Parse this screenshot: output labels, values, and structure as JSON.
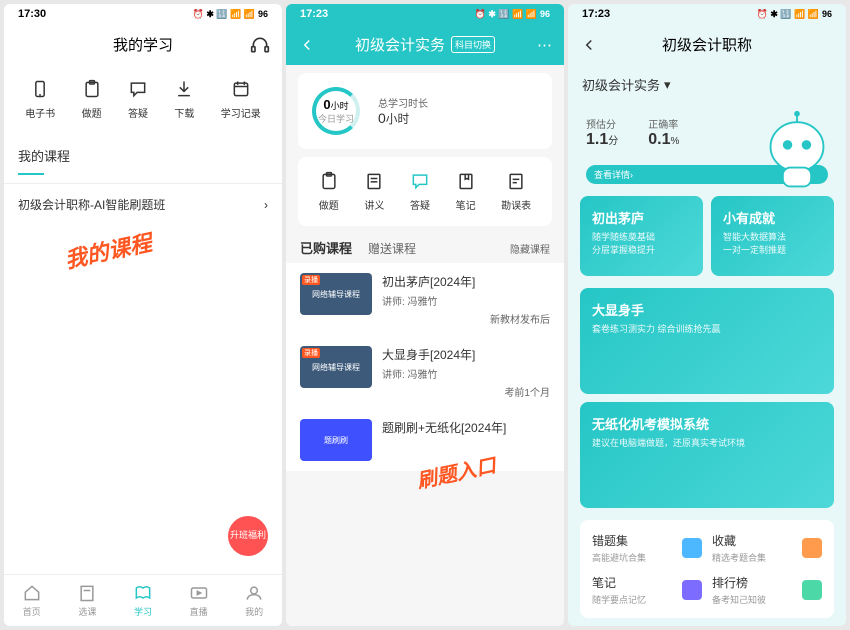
{
  "p1": {
    "time": "17:30",
    "status_badge": "43",
    "battery": "96",
    "title": "我的学习",
    "icons": [
      {
        "name": "ebook-icon",
        "label": "电子书"
      },
      {
        "name": "practice-icon",
        "label": "做题"
      },
      {
        "name": "qa-icon",
        "label": "答疑"
      },
      {
        "name": "download-icon",
        "label": "下载"
      },
      {
        "name": "record-icon",
        "label": "学习记录"
      }
    ],
    "section": "我的课程",
    "course": "初级会计职称-AI智能刷题班",
    "stamp": "我的课程",
    "fab": "升班福利",
    "nav": [
      {
        "name": "home",
        "label": "首页"
      },
      {
        "name": "select",
        "label": "选课"
      },
      {
        "name": "study",
        "label": "学习",
        "active": true
      },
      {
        "name": "live",
        "label": "直播"
      },
      {
        "name": "mine",
        "label": "我的"
      }
    ]
  },
  "p2": {
    "time": "17:23",
    "status_badge": "43",
    "battery": "96",
    "title": "初级会计实务",
    "switch": "科目切换",
    "stats": {
      "today_val": "0",
      "today_unit": "小时",
      "today_label": "今日学习",
      "total_label": "总学习时长",
      "total_val": "0",
      "total_unit": "小时"
    },
    "icons": [
      {
        "name": "practice-icon",
        "label": "做题"
      },
      {
        "name": "lecture-icon",
        "label": "讲义"
      },
      {
        "name": "qa-icon",
        "label": "答疑"
      },
      {
        "name": "notes-icon",
        "label": "笔记"
      },
      {
        "name": "errata-icon",
        "label": "勘误表"
      }
    ],
    "tabs": {
      "t1": "已购课程",
      "t2": "赠送课程",
      "right": "隐藏课程"
    },
    "courses": [
      {
        "title": "初出茅庐[2024年]",
        "teacher": "讲师: 冯雅竹",
        "meta": "新教材发布后",
        "thumb_tag": "录播",
        "thumb_text": "网络辅导课程"
      },
      {
        "title": "大显身手[2024年]",
        "teacher": "讲师: 冯雅竹",
        "meta": "考前1个月",
        "thumb_tag": "录播",
        "thumb_text": "网络辅导课程"
      },
      {
        "title": "题刷刷+无纸化[2024年]",
        "teacher": "",
        "meta": "",
        "thumb_tag": "",
        "thumb_text": "题刷刷",
        "blue": true
      }
    ],
    "stamp": "刷题入口"
  },
  "p3": {
    "time": "17:23",
    "status_badge": "43",
    "battery": "96",
    "title": "初级会计职称",
    "dropdown": "初级会计实务",
    "scores": {
      "l1": "预估分",
      "v1": "1.1",
      "u1": "分",
      "l2": "正确率",
      "v2": "0.1",
      "u2": "%"
    },
    "detail": "查看详情",
    "cards": [
      {
        "title": "初出茅庐",
        "sub": "随学随练奠基础\n分层掌握稳提升"
      },
      {
        "title": "小有成就",
        "sub": "智能大数据算法\n一对一定制推题"
      }
    ],
    "wide1": {
      "title": "大显身手",
      "sub": "套卷练习测实力 综合训练抢先赢"
    },
    "wide2": {
      "title": "无纸化机考模拟系统",
      "sub": "建议在电脑端做题，还原真实考试环境"
    },
    "grid": [
      {
        "t": "错题集",
        "s": "高能避坑合集",
        "c": "#4db8ff"
      },
      {
        "t": "收藏",
        "s": "精选考题合集",
        "c": "#ff9b4d"
      },
      {
        "t": "笔记",
        "s": "随学要点记忆",
        "c": "#7c6cff"
      },
      {
        "t": "排行榜",
        "s": "备考知己知彼",
        "c": "#4dd8a8"
      }
    ]
  }
}
